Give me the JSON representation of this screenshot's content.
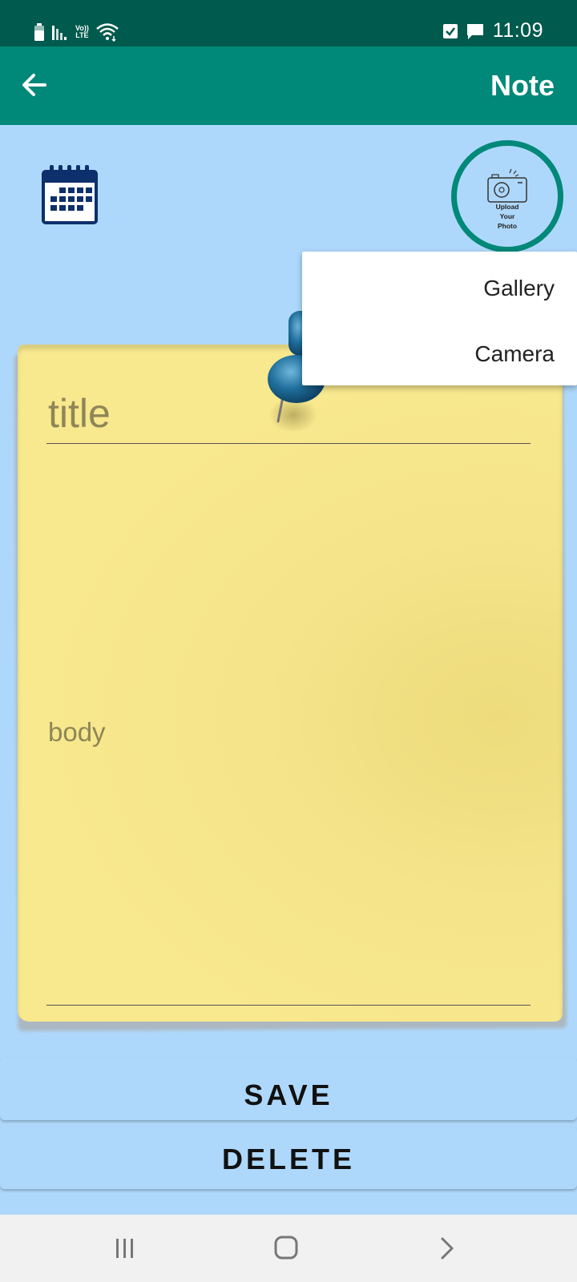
{
  "status_bar": {
    "time": "11:09",
    "volte_label": "Vo))",
    "lte_label": "LTE",
    "icons": [
      "battery-icon",
      "signal-icon",
      "volte-icon",
      "wifi-icon",
      "checkbox-notification-icon",
      "message-notification-icon"
    ]
  },
  "app_bar": {
    "title": "Note",
    "back_icon": "arrow-left-icon"
  },
  "toolbar": {
    "calendar_icon": "calendar-icon",
    "photo_button_label_line1": "Upload",
    "photo_button_label_line2": "Your",
    "photo_button_label_line3": "Photo",
    "photo_icon": "camera-icon"
  },
  "popup_menu": {
    "items": [
      {
        "label": "Gallery"
      },
      {
        "label": "Camera"
      }
    ]
  },
  "note": {
    "title_placeholder": "title",
    "title_value": "",
    "body_placeholder": "body",
    "body_value": ""
  },
  "actions": {
    "save_label": "SAVE",
    "delete_label": "DELETE"
  },
  "nav_bar": {
    "icons": [
      "recents-icon",
      "home-icon",
      "back-chevron-icon"
    ]
  },
  "colors": {
    "status_bar": "#005a4d",
    "app_bar": "#008878",
    "background": "#aed8fb",
    "note_paper": "#f8e88e",
    "calendar_blue": "#0d2f6b",
    "pin_blue": "#1f6f9c"
  }
}
